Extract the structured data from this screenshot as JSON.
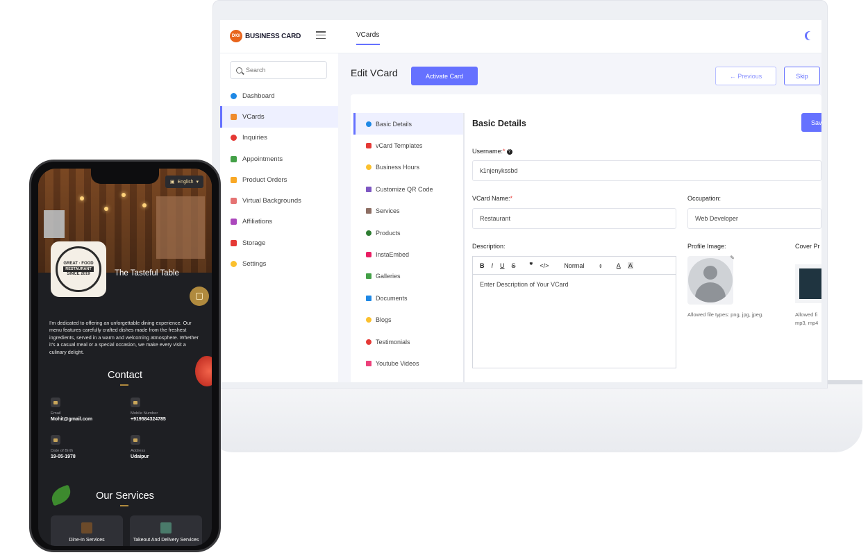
{
  "app": {
    "logo_badge": "DIGI",
    "logo_text": "BUSINESS CARD",
    "top_tab": "VCards",
    "accent": "#6571ff"
  },
  "sidebar": {
    "search_placeholder": "Search",
    "items": [
      {
        "label": "Dashboard",
        "icon": "dashboard-icon",
        "color": "#1e88e5"
      },
      {
        "label": "VCards",
        "icon": "vcard-icon",
        "color": "#ef8b2c",
        "active": true
      },
      {
        "label": "Inquiries",
        "icon": "inquiries-icon",
        "color": "#e53935"
      },
      {
        "label": "Appointments",
        "icon": "calendar-icon",
        "color": "#43a047"
      },
      {
        "label": "Product Orders",
        "icon": "orders-icon",
        "color": "#f9a825"
      },
      {
        "label": "Virtual Backgrounds",
        "icon": "background-icon",
        "color": "#e57373"
      },
      {
        "label": "Affiliations",
        "icon": "affiliations-icon",
        "color": "#ab47bc"
      },
      {
        "label": "Storage",
        "icon": "storage-icon",
        "color": "#e53935"
      },
      {
        "label": "Settings",
        "icon": "settings-icon",
        "color": "#fbc02d"
      }
    ]
  },
  "content": {
    "title": "Edit VCard",
    "activate_label": "Activate Card",
    "previous_label": "← Previous",
    "skip_label": "Skip"
  },
  "subnav": {
    "items": [
      {
        "label": "Basic Details",
        "color": "#1e88e5",
        "active": true
      },
      {
        "label": "vCard Templates",
        "color": "#e53935"
      },
      {
        "label": "Business Hours",
        "color": "#fbc02d"
      },
      {
        "label": "Customize QR Code",
        "color": "#7e57c2"
      },
      {
        "label": "Services",
        "color": "#8d6e63"
      },
      {
        "label": "Products",
        "color": "#2e7d32"
      },
      {
        "label": "InstaEmbed",
        "color": "#e91e63"
      },
      {
        "label": "Galleries",
        "color": "#43a047"
      },
      {
        "label": "Documents",
        "color": "#1e88e5"
      },
      {
        "label": "Blogs",
        "color": "#fbc02d"
      },
      {
        "label": "Testimonials",
        "color": "#e53935"
      },
      {
        "label": "Youtube Videos",
        "color": "#ec407a"
      }
    ]
  },
  "form": {
    "title": "Basic Details",
    "save_label": "Save",
    "username_label": "Username:",
    "username_value": "k1njenykssbd",
    "vcard_name_label": "VCard Name:",
    "vcard_name_value": "Restaurant",
    "occupation_label": "Occupation:",
    "occupation_value": "Web Developer",
    "description_label": "Description:",
    "editor_style": "Normal",
    "editor_placeholder": "Enter Description of Your VCard",
    "profile_label": "Profile Image:",
    "profile_hint": "Allowed file types: png, jpg, jpeg.",
    "cover_label": "Cover Pr",
    "cover_hint_1": "Allowed fi",
    "cover_hint_2": "mp3, mp4"
  },
  "phone": {
    "language": "English",
    "business_name": "The Tasteful Table",
    "emblem_top": "GREAT · FOOD",
    "emblem_mid": "RESTAURANT",
    "emblem_bottom": "SINCE 2019",
    "about": "I'm dedicated to offering an unforgettable dining experience. Our menu features carefully crafted dishes made from the freshest ingredients, served in a warm and welcoming atmosphere. Whether it's a casual meal or a special occasion, we make every visit a culinary delight.",
    "contact_title": "Contact",
    "contacts": [
      {
        "label": "Email",
        "value": "Mohit@gmail.com"
      },
      {
        "label": "Mobile Number",
        "value": "+919584324785"
      },
      {
        "label": "Date of Birth",
        "value": "19-05-1978"
      },
      {
        "label": "Address",
        "value": "Udaipur"
      }
    ],
    "services_title": "Our Services",
    "services": [
      {
        "label": "Dine-In Services"
      },
      {
        "label": "Takeout And Delivery Services"
      }
    ]
  }
}
